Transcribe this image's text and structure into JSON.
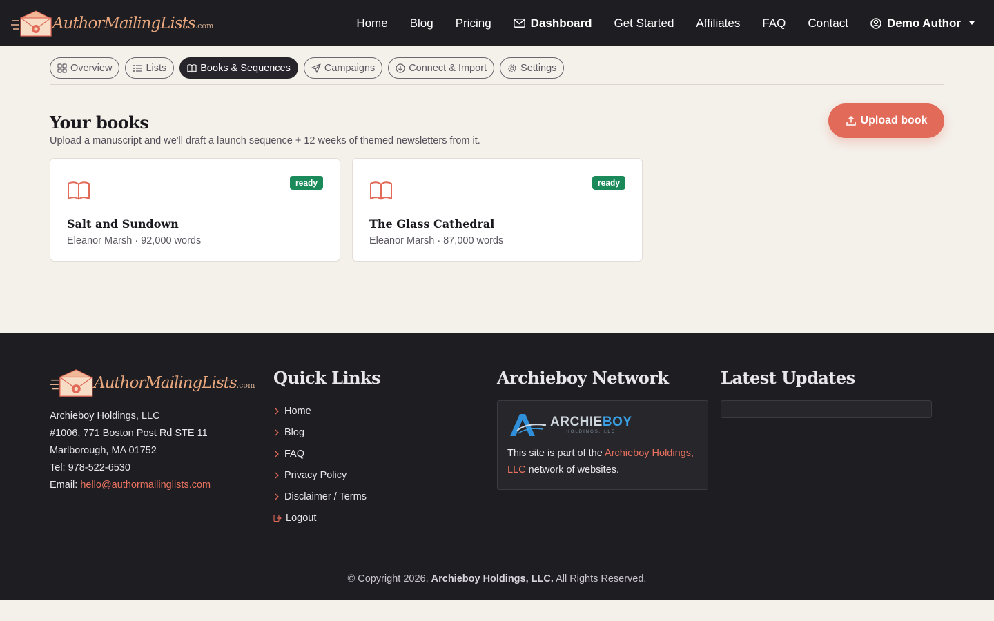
{
  "brand": {
    "name": "AuthorMailingLists",
    "tld": ".com"
  },
  "nav": {
    "items": [
      {
        "label": "Home"
      },
      {
        "label": "Blog"
      },
      {
        "label": "Pricing"
      },
      {
        "label": "Dashboard"
      },
      {
        "label": "Get Started"
      },
      {
        "label": "Affiliates"
      },
      {
        "label": "FAQ"
      },
      {
        "label": "Contact"
      }
    ],
    "user": "Demo Author"
  },
  "tabs": [
    {
      "label": "Overview",
      "icon": "grid-icon"
    },
    {
      "label": "Lists",
      "icon": "list-icon"
    },
    {
      "label": "Books & Sequences",
      "icon": "book-icon"
    },
    {
      "label": "Campaigns",
      "icon": "send-icon"
    },
    {
      "label": "Connect & Import",
      "icon": "download-icon"
    },
    {
      "label": "Settings",
      "icon": "gear-icon"
    }
  ],
  "main": {
    "title": "Your books",
    "subtitle": "Upload a manuscript and we'll draft a launch sequence + 12 weeks of themed newsletters from it.",
    "upload_label": "Upload book",
    "books": [
      {
        "title": "Salt and Sundown",
        "meta": "Eleanor Marsh · 92,000 words",
        "status": "ready"
      },
      {
        "title": "The Glass Cathedral",
        "meta": "Eleanor Marsh · 87,000 words",
        "status": "ready"
      }
    ]
  },
  "footer": {
    "address": {
      "company": "Archieboy Holdings, LLC",
      "line1": "#1006, 771 Boston Post Rd STE 11",
      "line2": "Marlborough, MA 01752",
      "tel": "Tel: 978-522-6530",
      "email_label": "Email: ",
      "email": "hello@authormailinglists.com"
    },
    "quick_links_title": "Quick Links",
    "quick_links": [
      "Home",
      "Blog",
      "FAQ",
      "Privacy Policy",
      "Disclaimer / Terms",
      "Logout"
    ],
    "network_title": "Archieboy Network",
    "network_logo": {
      "arch": "ARCHIE",
      "boy": "BOY",
      "sub": "HOLDINGS, LLC"
    },
    "network_text_pre": "This site is part of the ",
    "network_link": "Archieboy Holdings, LLC",
    "network_text_post": " network of websites.",
    "updates_title": "Latest Updates",
    "copyright_pre": "© Copyright 2026, ",
    "copyright_company": "Archieboy Holdings, LLC.",
    "copyright_post": " All Rights Reserved."
  },
  "colors": {
    "accent": "#e26a59",
    "dark": "#1e1d22",
    "ready": "#1b8a5a",
    "background": "#f4f0ea"
  }
}
